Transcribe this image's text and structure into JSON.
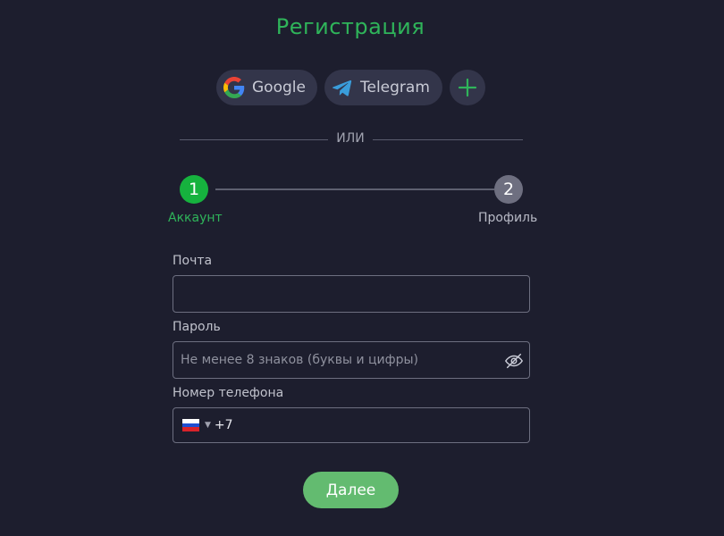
{
  "title": "Регистрация",
  "social": {
    "google_label": "Google",
    "telegram_label": "Telegram",
    "more_icon": "plus-icon"
  },
  "divider_text": "ИЛИ",
  "steps": [
    {
      "number": "1",
      "label": "Аккаунт",
      "state": "active"
    },
    {
      "number": "2",
      "label": "Профиль",
      "state": "inactive"
    }
  ],
  "form": {
    "email": {
      "label": "Почта",
      "value": "",
      "placeholder": ""
    },
    "password": {
      "label": "Пароль",
      "value": "",
      "placeholder": "Не менее 8 знаков (буквы и цифры)"
    },
    "phone": {
      "label": "Номер телефона",
      "country_icon": "russia-flag-icon",
      "code": "+7",
      "value": ""
    }
  },
  "submit_label": "Далее",
  "colors": {
    "background": "#1d1e2e",
    "accent": "#2fb45a",
    "step_active": "#16b23e",
    "step_inactive": "#6e6f80",
    "button": "#63bb70"
  }
}
